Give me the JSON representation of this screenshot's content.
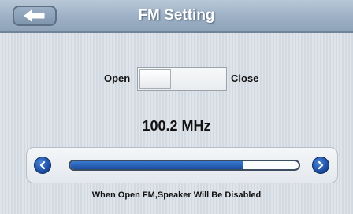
{
  "header": {
    "title": "FM Setting",
    "back_icon": "back-arrow-icon"
  },
  "toggle": {
    "open_label": "Open",
    "close_label": "Close",
    "state": "open"
  },
  "frequency": {
    "display": "100.2 MHz"
  },
  "slider": {
    "left_icon": "chevron-left-icon",
    "right_icon": "chevron-right-icon",
    "fill_fraction": 0.76
  },
  "notice": "When Open FM,Speaker Will Be Disabled",
  "colors": {
    "header": "#9fb2c6",
    "accent_blue": "#1d4fa3",
    "title_text": "#ffffff"
  }
}
